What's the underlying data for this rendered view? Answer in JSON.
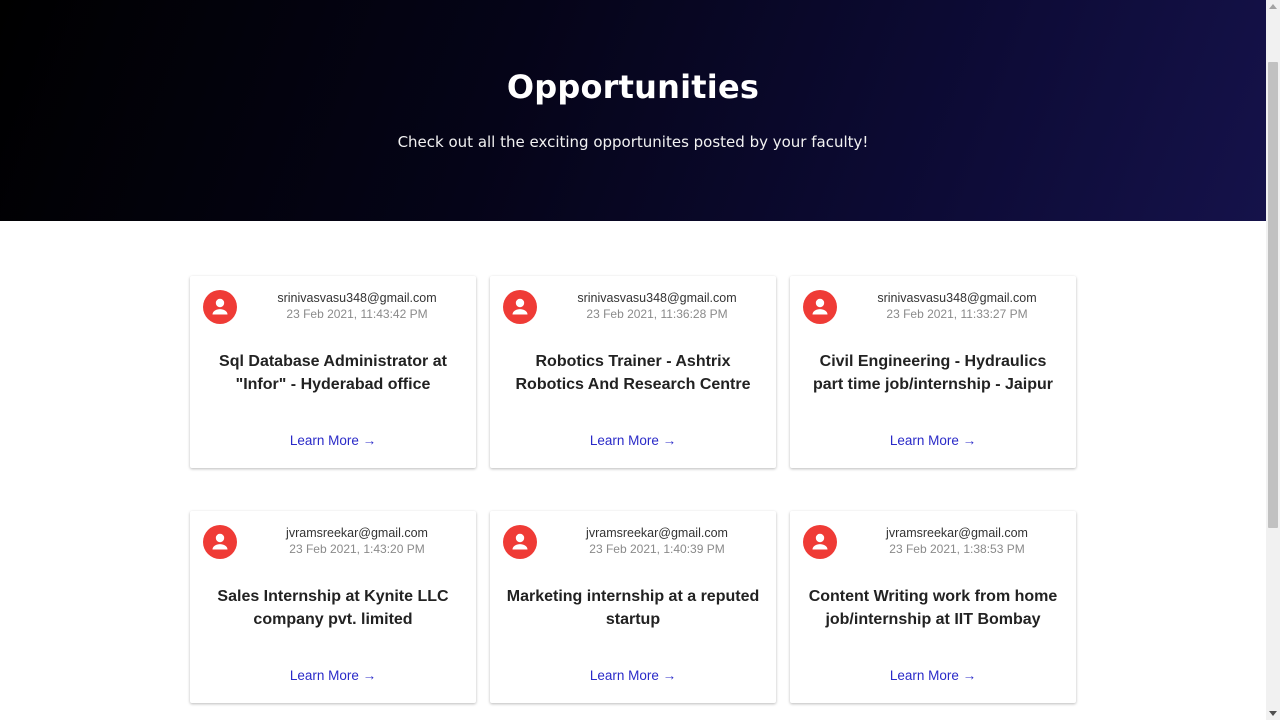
{
  "hero": {
    "title": "Opportunities",
    "subtitle": "Check out all the exciting opportunites posted by your faculty!"
  },
  "colors": {
    "avatar": "#ef3b36",
    "link": "#2a2ac8",
    "hero_dark": "#000000",
    "hero_navy": "#15124a"
  },
  "opportunities": [
    {
      "email": "srinivasvasu348@gmail.com",
      "date": "23 Feb 2021, 11:43:42 PM",
      "title": "Sql Database Administrator at \"Infor\" - Hyderabad office",
      "link_label": "Learn More →",
      "icon": "user-avatar-icon"
    },
    {
      "email": "srinivasvasu348@gmail.com",
      "date": "23 Feb 2021, 11:36:28 PM",
      "title": "Robotics Trainer - Ashtrix Robotics And Research Centre",
      "link_label": "Learn More →",
      "icon": "user-avatar-icon"
    },
    {
      "email": "srinivasvasu348@gmail.com",
      "date": "23 Feb 2021, 11:33:27 PM",
      "title": "Civil Engineering - Hydraulics part time job/internship - Jaipur",
      "link_label": "Learn More →",
      "icon": "user-avatar-icon"
    },
    {
      "email": "jvramsreekar@gmail.com",
      "date": "23 Feb 2021, 1:43:20 PM",
      "title": "Sales Internship at Kynite LLC company pvt. limited",
      "link_label": "Learn More →",
      "icon": "user-avatar-icon"
    },
    {
      "email": "jvramsreekar@gmail.com",
      "date": "23 Feb 2021, 1:40:39 PM",
      "title": "Marketing internship at a reputed startup",
      "link_label": "Learn More →",
      "icon": "user-avatar-icon"
    },
    {
      "email": "jvramsreekar@gmail.com",
      "date": "23 Feb 2021, 1:38:53 PM",
      "title": "Content Writing work from home job/internship at IIT Bombay",
      "link_label": "Learn More →",
      "icon": "user-avatar-icon"
    }
  ]
}
